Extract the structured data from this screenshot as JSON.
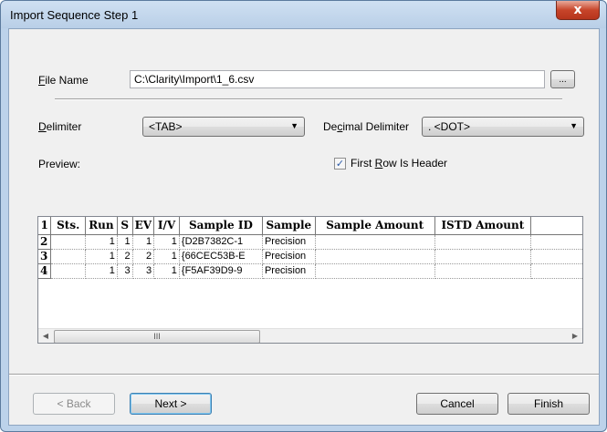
{
  "window": {
    "title": "Import Sequence Step 1",
    "close_glyph": "x"
  },
  "file": {
    "label": "File Name",
    "value": "C:\\Clarity\\Import\\1_6.csv",
    "browse_label": "..."
  },
  "delimiter": {
    "label": "Delimiter",
    "value": "<TAB>"
  },
  "decimal_delimiter": {
    "label": "Decimal Delimiter",
    "value": ". <DOT>"
  },
  "preview": {
    "label": "Preview:"
  },
  "first_row_header": {
    "label": "First Row Is Header",
    "checked": true
  },
  "grid": {
    "headers": [
      "1",
      "Sts.",
      "Run",
      "S",
      "EV",
      "I/V",
      "Sample ID",
      "Sample",
      "Sample Amount",
      "ISTD Amount",
      ""
    ],
    "rows": [
      [
        "2",
        "",
        "1",
        "1",
        "1",
        "1",
        "{D2B7382C-1",
        "Precision",
        "",
        "",
        ""
      ],
      [
        "3",
        "",
        "1",
        "2",
        "2",
        "1",
        "{66CEC53B-E",
        "Precision",
        "",
        "",
        ""
      ],
      [
        "4",
        "",
        "1",
        "3",
        "3",
        "1",
        "{F5AF39D9-9",
        "Precision",
        "",
        "",
        ""
      ]
    ],
    "scroll_thumb_glyph": "III"
  },
  "buttons": {
    "back": "< Back",
    "next": "Next >",
    "cancel": "Cancel",
    "finish": "Finish"
  },
  "colors": {
    "title_bar": "#bcd2ea",
    "close_button": "#c7452a",
    "client_bg": "#f0f0f0",
    "default_button_border": "#3c7fb1"
  }
}
